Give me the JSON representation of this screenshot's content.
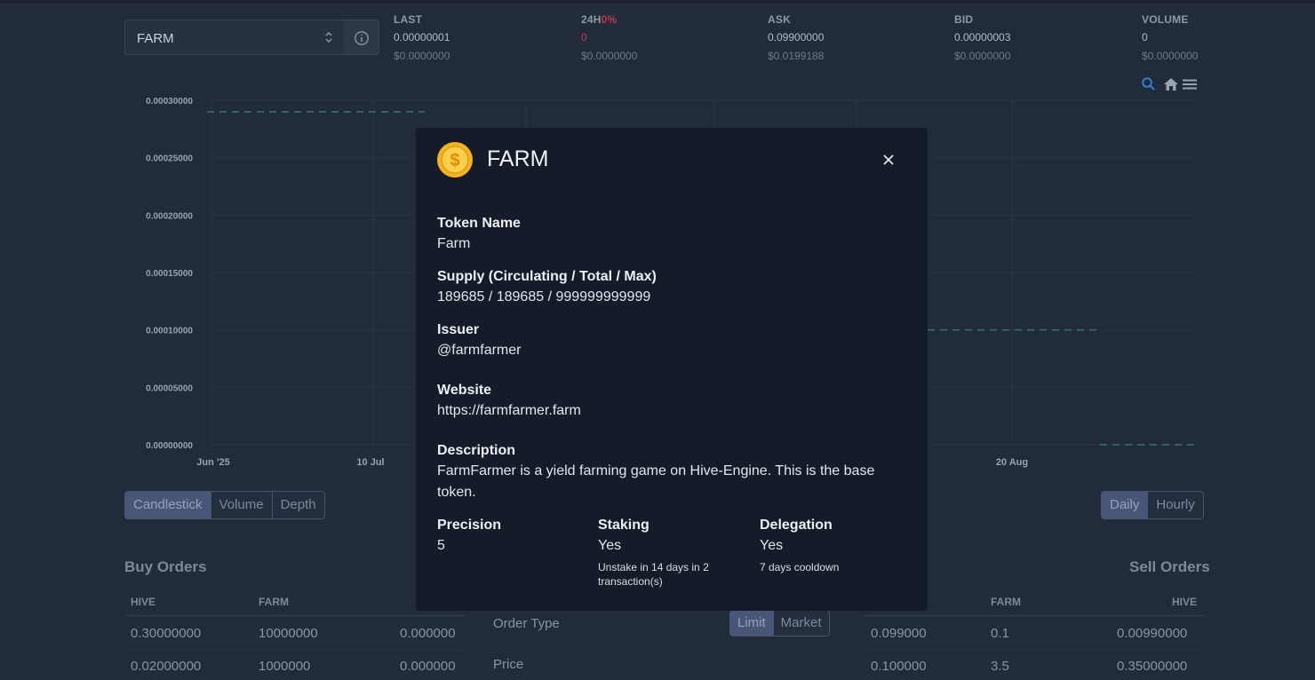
{
  "selector": {
    "token": "FARM",
    "info_icon": "info-circle-icon",
    "arrows_icon": "up-down-chevron-icon"
  },
  "stats": [
    {
      "label": "LAST",
      "value": "0.00000001",
      "usd": "$0.0000000"
    },
    {
      "label": "24H",
      "pct": "0%",
      "value": "0",
      "usd": "$0.0000000"
    },
    {
      "label": "ASK",
      "value": "0.09900000",
      "usd": "$0.0199188"
    },
    {
      "label": "BID",
      "value": "0.00000003",
      "usd": "$0.0000000"
    },
    {
      "label": "VOLUME",
      "value": "0",
      "usd": "$0.0000000"
    }
  ],
  "chart_tools": {
    "zoom_icon": "magnifier-icon",
    "home_icon": "home-icon",
    "menu_icon": "hamburger-menu-icon"
  },
  "chart_data": {
    "type": "line",
    "y_ticks": [
      "0.00030000",
      "0.00025000",
      "0.00020000",
      "0.00015000",
      "0.00010000",
      "0.00005000",
      "0.00000000"
    ],
    "x_ticks": [
      "Jun '25",
      "10 Jul",
      "20 Aug"
    ],
    "ylim": [
      0,
      0.0003
    ],
    "grid": true,
    "colors": {
      "line": "#2b7d6a",
      "grid": "#2b3444"
    }
  },
  "chart_buttons": [
    "Candlestick",
    "Volume",
    "Depth"
  ],
  "period_buttons": [
    "Daily",
    "Hourly"
  ],
  "buy_orders": {
    "title": "Buy Orders",
    "headers": [
      "HIVE",
      "FARM"
    ],
    "rows": [
      [
        "0.30000000",
        "10000000",
        "0.000000"
      ],
      [
        "0.02000000",
        "1000000",
        "0.000000"
      ]
    ]
  },
  "sell_orders": {
    "title": "Sell Orders",
    "headers": [
      "FARM",
      "HIVE"
    ],
    "rows": [
      [
        "0.099000",
        "0.1",
        "0.00990000"
      ],
      [
        "0.100000",
        "3.5",
        "0.35000000"
      ]
    ]
  },
  "order_form": {
    "order_type_label": "Order Type",
    "types": [
      "Limit",
      "Market"
    ],
    "price_label": "Price"
  },
  "modal": {
    "title": "FARM",
    "coin_icon": "gold-coin-icon",
    "close_icon": "close-icon",
    "token_name_label": "Token Name",
    "token_name": "Farm",
    "supply_label": "Supply (Circulating / Total / Max)",
    "supply": "189685 / 189685 / 999999999999",
    "issuer_label": "Issuer",
    "issuer": "@farmfarmer",
    "website_label": "Website",
    "website": "https://farmfarmer.farm",
    "description_label": "Description",
    "description": "FarmFarmer is a yield farming game on Hive-Engine. This is the base token.",
    "precision_label": "Precision",
    "precision": "5",
    "staking_label": "Staking",
    "staking": "Yes",
    "staking_note": "Unstake in 14 days in 2 transaction(s)",
    "delegation_label": "Delegation",
    "delegation": "Yes",
    "delegation_note": "7 days cooldown"
  },
  "colors": {
    "background": "#222b3a",
    "modal": "#141b29",
    "negative": "#c0394b",
    "accent_line": "#2b7d6a"
  }
}
